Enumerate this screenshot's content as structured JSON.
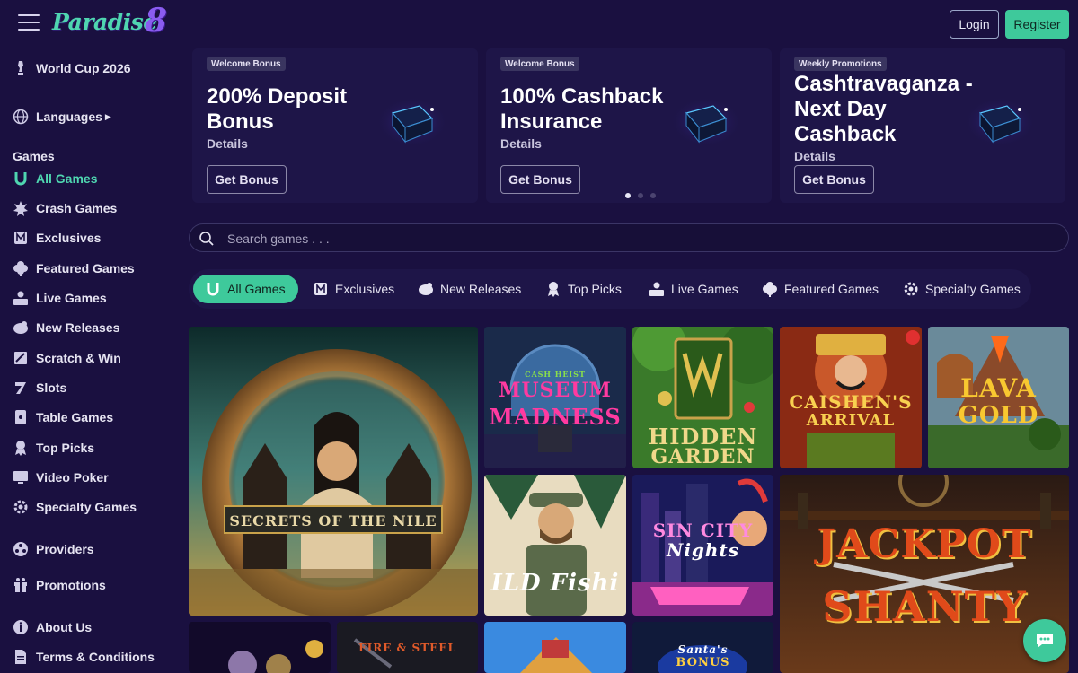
{
  "header": {
    "logo_text": "Paradise",
    "logo_number": "8",
    "login_label": "Login",
    "register_label": "Register"
  },
  "sidebar": {
    "world_cup": "World Cup 2026",
    "languages": "Languages",
    "games_heading": "Games",
    "games": [
      {
        "label": "All Games",
        "icon": "horseshoe-icon",
        "active": true
      },
      {
        "label": "Crash Games",
        "icon": "explosion-icon"
      },
      {
        "label": "Exclusives",
        "icon": "exclusive-icon"
      },
      {
        "label": "Featured Games",
        "icon": "clover-icon"
      },
      {
        "label": "Live Games",
        "icon": "live-dealer-icon"
      },
      {
        "label": "New Releases",
        "icon": "new-release-icon"
      },
      {
        "label": "Scratch & Win",
        "icon": "scratch-card-icon"
      },
      {
        "label": "Slots",
        "icon": "seven-icon"
      },
      {
        "label": "Table Games",
        "icon": "table-card-icon"
      },
      {
        "label": "Top Picks",
        "icon": "award-icon"
      },
      {
        "label": "Video Poker",
        "icon": "video-poker-icon"
      },
      {
        "label": "Specialty Games",
        "icon": "gear-icon"
      }
    ],
    "providers": "Providers",
    "promotions": "Promotions",
    "about": "About Us",
    "terms": "Terms & Conditions"
  },
  "promos": [
    {
      "badge": "Welcome Bonus",
      "title": "200% Deposit Bonus",
      "details": "Details",
      "cta": "Get Bonus"
    },
    {
      "badge": "Welcome Bonus",
      "title": "100% Cashback Insurance",
      "details": "Details",
      "cta": "Get Bonus"
    },
    {
      "badge": "Weekly Promotions",
      "title": "Cashtravaganza - Next Day Cashback",
      "details": "Details",
      "cta": "Get Bonus"
    }
  ],
  "carousel": {
    "active_index": 0,
    "count": 3
  },
  "search": {
    "placeholder": "Search games . . ."
  },
  "tabs": [
    {
      "label": "All Games",
      "icon": "horseshoe-icon",
      "active": true
    },
    {
      "label": "Exclusives",
      "icon": "exclusive-icon"
    },
    {
      "label": "New Releases",
      "icon": "new-release-icon"
    },
    {
      "label": "Top Picks",
      "icon": "award-icon"
    },
    {
      "label": "Live Games",
      "icon": "live-dealer-icon"
    },
    {
      "label": "Featured Games",
      "icon": "clover-icon"
    },
    {
      "label": "Specialty Games",
      "icon": "gear-icon"
    }
  ],
  "games": {
    "secrets_nile": "SECRETS OF THE NILE",
    "museum_madness_top": "CASH HEIST",
    "museum_madness_a": "MUSEUM",
    "museum_madness_b": "MADNESS",
    "hidden_garden_a": "HIDDEN",
    "hidden_garden_b": "GARDEN",
    "caishens_a": "CAISHEN'S",
    "caishens_b": "ARRIVAL",
    "lava_gold_a": "LAVA",
    "lava_gold_b": "GOLD",
    "wild_fishing": "ILD Fishi",
    "sin_city_a": "SIN CITY",
    "sin_city_b": "Nights",
    "jackpot_a": "JACKPOT",
    "jackpot_b": "SHANTY",
    "fire_steel": "FIRE & STEEL",
    "santas_bonus_a": "Santa's",
    "santas_bonus_b": "BONUS"
  },
  "colors": {
    "background": "#1a1040",
    "accent": "#3ec99b",
    "card": "#1e1548"
  }
}
